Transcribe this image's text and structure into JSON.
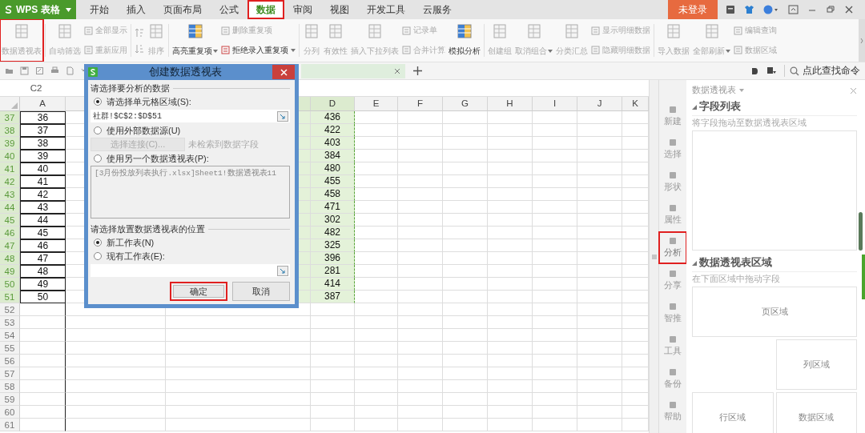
{
  "app": {
    "logo": "WPS 表格"
  },
  "menu_tabs": [
    {
      "label": "开始",
      "selected": false,
      "highlighted": false
    },
    {
      "label": "插入",
      "selected": false,
      "highlighted": false
    },
    {
      "label": "页面布局",
      "selected": false,
      "highlighted": false
    },
    {
      "label": "公式",
      "selected": false,
      "highlighted": false
    },
    {
      "label": "数据",
      "selected": true,
      "highlighted": true
    },
    {
      "label": "审阅",
      "selected": false,
      "highlighted": false
    },
    {
      "label": "视图",
      "selected": false,
      "highlighted": false
    },
    {
      "label": "开发工具",
      "selected": false,
      "highlighted": false
    },
    {
      "label": "云服务",
      "selected": false,
      "highlighted": false
    }
  ],
  "login_button": "未登录",
  "ribbon": [
    {
      "kind": "large",
      "label": "数据透视表",
      "disabled": true,
      "dropdown": false,
      "highlighted": true
    },
    {
      "kind": "separator"
    },
    {
      "kind": "large",
      "label": "自动筛选",
      "disabled": true,
      "dropdown": false,
      "highlighted": false
    },
    {
      "kind": "stack",
      "items": [
        {
          "label": "全部显示",
          "disabled": true,
          "dropdown": false
        },
        {
          "label": "重新应用",
          "disabled": true,
          "dropdown": false
        }
      ]
    },
    {
      "kind": "separator"
    },
    {
      "kind": "sort_icons"
    },
    {
      "kind": "large",
      "label": "排序",
      "disabled": true,
      "dropdown": false,
      "highlighted": false
    },
    {
      "kind": "separator"
    },
    {
      "kind": "large",
      "label": "高亮重复项",
      "disabled": false,
      "dropdown": true,
      "highlighted": false
    },
    {
      "kind": "stack",
      "items": [
        {
          "label": "删除重复项",
          "disabled": true,
          "dropdown": false
        },
        {
          "label": "拒绝录入重复项",
          "disabled": false,
          "dropdown": true
        }
      ]
    },
    {
      "kind": "separator"
    },
    {
      "kind": "large",
      "label": "分列",
      "disabled": true,
      "dropdown": false,
      "highlighted": false
    },
    {
      "kind": "large",
      "label": "有效性",
      "disabled": true,
      "dropdown": false,
      "highlighted": false
    },
    {
      "kind": "large",
      "label": "插入下拉列表",
      "disabled": true,
      "dropdown": false,
      "highlighted": false
    },
    {
      "kind": "stack",
      "items": [
        {
          "label": "记录单",
          "disabled": true,
          "dropdown": false
        },
        {
          "label": "合并计算",
          "disabled": true,
          "dropdown": false
        }
      ]
    },
    {
      "kind": "large",
      "label": "模拟分析",
      "disabled": false,
      "dropdown": false,
      "highlighted": false
    },
    {
      "kind": "separator"
    },
    {
      "kind": "large",
      "label": "创建组",
      "disabled": true,
      "dropdown": false,
      "highlighted": false
    },
    {
      "kind": "large",
      "label": "取消组合",
      "disabled": true,
      "dropdown": true,
      "highlighted": false
    },
    {
      "kind": "large",
      "label": "分类汇总",
      "disabled": true,
      "dropdown": false,
      "highlighted": false
    },
    {
      "kind": "stack",
      "items": [
        {
          "label": "显示明细数据",
          "disabled": true,
          "dropdown": false
        },
        {
          "label": "隐藏明细数据",
          "disabled": true,
          "dropdown": false
        }
      ]
    },
    {
      "kind": "separator"
    },
    {
      "kind": "large",
      "label": "导入数据",
      "disabled": true,
      "dropdown": false,
      "highlighted": false
    },
    {
      "kind": "large",
      "label": "全部刷新",
      "disabled": true,
      "dropdown": true,
      "highlighted": false
    },
    {
      "kind": "stack",
      "items": [
        {
          "label": "编辑查询",
          "disabled": true,
          "dropdown": false
        },
        {
          "label": "数据区域",
          "disabled": true,
          "dropdown": false
        }
      ]
    }
  ],
  "search": {
    "placeholder": "点此查找命令"
  },
  "name_box": "C2",
  "columns": [
    {
      "kind": "header",
      "label": "A",
      "selected": false
    },
    {
      "kind": "covered",
      "selected": false
    },
    {
      "kind": "covered",
      "selected": true
    },
    {
      "kind": "header",
      "label": "D",
      "selected": true
    },
    {
      "kind": "header",
      "label": "E",
      "selected": false
    },
    {
      "kind": "header",
      "label": "F",
      "selected": false
    },
    {
      "kind": "header",
      "label": "G",
      "selected": false
    },
    {
      "kind": "header",
      "label": "H",
      "selected": false
    },
    {
      "kind": "header",
      "label": "I",
      "selected": false
    },
    {
      "kind": "header",
      "label": "J",
      "selected": false
    },
    {
      "kind": "header",
      "label": "K",
      "selected": false
    }
  ],
  "rows": [
    {
      "number": "37",
      "selected": true,
      "column_a": "36",
      "column_d": "436"
    },
    {
      "number": "38",
      "selected": true,
      "column_a": "37",
      "column_d": "422"
    },
    {
      "number": "39",
      "selected": true,
      "column_a": "38",
      "column_d": "403"
    },
    {
      "number": "40",
      "selected": true,
      "column_a": "39",
      "column_d": "384"
    },
    {
      "number": "41",
      "selected": true,
      "column_a": "40",
      "column_d": "480"
    },
    {
      "number": "42",
      "selected": true,
      "column_a": "41",
      "column_d": "455"
    },
    {
      "number": "43",
      "selected": true,
      "column_a": "42",
      "column_d": "458"
    },
    {
      "number": "44",
      "selected": true,
      "column_a": "43",
      "column_d": "471"
    },
    {
      "number": "45",
      "selected": true,
      "column_a": "44",
      "column_d": "302"
    },
    {
      "number": "46",
      "selected": true,
      "column_a": "45",
      "column_d": "482"
    },
    {
      "number": "47",
      "selected": true,
      "column_a": "46",
      "column_d": "325"
    },
    {
      "number": "48",
      "selected": true,
      "column_a": "47",
      "column_d": "396"
    },
    {
      "number": "49",
      "selected": true,
      "column_a": "48",
      "column_d": "281"
    },
    {
      "number": "50",
      "selected": true,
      "column_a": "49",
      "column_d": "414"
    },
    {
      "number": "51",
      "selected": true,
      "column_a": "50",
      "column_d": "387"
    },
    {
      "number": "52",
      "selected": false
    },
    {
      "number": "53",
      "selected": false
    },
    {
      "number": "54",
      "selected": false
    },
    {
      "number": "55",
      "selected": false
    },
    {
      "number": "56",
      "selected": false
    },
    {
      "number": "57",
      "selected": false
    },
    {
      "number": "58",
      "selected": false
    },
    {
      "number": "59",
      "selected": false
    },
    {
      "number": "60",
      "selected": false
    },
    {
      "number": "61",
      "selected": false
    }
  ],
  "dialog": {
    "title": "创建数据透视表",
    "sections": [
      {
        "heading": "请选择要分析的数据",
        "options": [
          {
            "kind": "field",
            "label": "请选择单元格区域(S):",
            "selected": true,
            "value": "社群!$C$2:$D$51"
          },
          {
            "kind": "connection",
            "label": "使用外部数据源(U)",
            "selected": false,
            "button": "选择连接(C)...",
            "button_disabled": true,
            "note": "未检索到数据字段"
          },
          {
            "kind": "list",
            "label": "使用另一个数据透视表(P):",
            "selected": false,
            "item": "[3月份投放列表执行.xlsx]Sheet1!数据透视表11"
          }
        ]
      },
      {
        "heading": "请选择放置数据透视表的位置",
        "options": [
          {
            "kind": "plain",
            "label": "新工作表(N)",
            "selected": true
          },
          {
            "kind": "field",
            "label": "现有工作表(E):",
            "selected": false
          }
        ]
      }
    ],
    "buttons": [
      {
        "label": "确定",
        "highlighted": true
      },
      {
        "label": "取消",
        "highlighted": false
      }
    ]
  },
  "side_tools": [
    {
      "label": "新建",
      "highlighted": false
    },
    {
      "label": "选择",
      "highlighted": false
    },
    {
      "label": "形状",
      "highlighted": false
    },
    {
      "label": "属性",
      "highlighted": false
    },
    {
      "label": "分析",
      "highlighted": true
    },
    {
      "label": "分享",
      "highlighted": false
    },
    {
      "label": "智推",
      "highlighted": false
    },
    {
      "label": "工具",
      "highlighted": false
    },
    {
      "label": "备份",
      "highlighted": false
    },
    {
      "label": "帮助",
      "highlighted": false
    }
  ],
  "panel": {
    "title": "数据透视表",
    "field_list": {
      "heading": "字段列表",
      "hint": "将字段拖动至数据透视表区域"
    },
    "areas_section": {
      "heading": "数据透视表区域",
      "hint": "在下面区域中拖动字段"
    },
    "areas": [
      {
        "kind": "page",
        "label": "页区域"
      },
      {
        "kind": "column",
        "label": "列区域"
      },
      {
        "kind": "row",
        "label": "行区域"
      },
      {
        "kind": "data",
        "label": "数据区域"
      }
    ]
  }
}
